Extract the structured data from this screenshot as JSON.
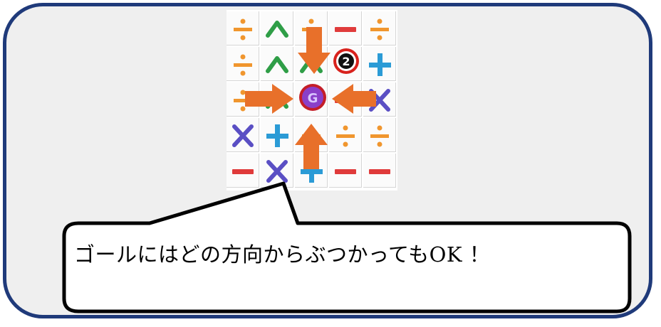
{
  "callout": {
    "text": "ゴールにはどの方向からぶつかってもOK ！"
  },
  "board": {
    "tiles": [
      [
        "divide",
        "caret-up",
        "divide",
        "minus",
        "divide"
      ],
      [
        "divide",
        "caret-up",
        "caret-up",
        "minus",
        "plus"
      ],
      [
        "divide",
        "caret-up",
        "goal",
        "minus",
        "times"
      ],
      [
        "times",
        "plus",
        "divide",
        "divide",
        "divide"
      ],
      [
        "minus",
        "times",
        "plus",
        "minus",
        "minus"
      ]
    ],
    "goal_label": "G",
    "badge_label": "2"
  },
  "colors": {
    "frame_border": "#1f3a7a",
    "frame_fill": "#efefef",
    "arrow": "#e8702a",
    "divide": "#f0962e",
    "caret": "#2f9e47",
    "minus": "#e03b3b",
    "plus": "#2b9bd6",
    "times": "#5a4fc4",
    "goal": "#8a3fc9"
  }
}
